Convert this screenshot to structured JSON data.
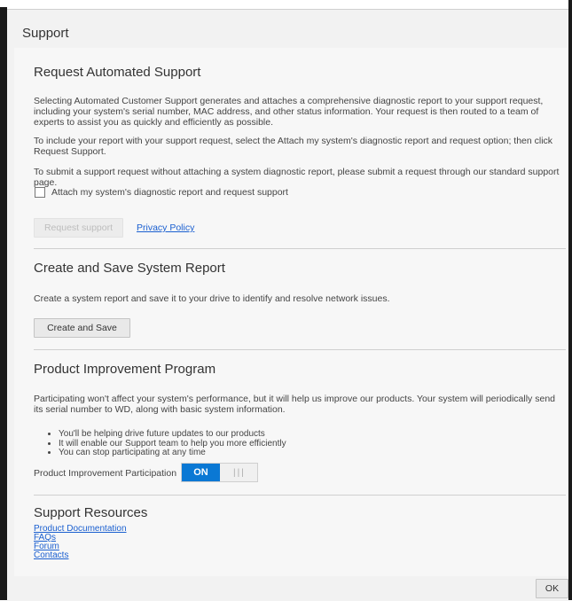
{
  "dialog": {
    "title": "Support",
    "ok_label": "OK"
  },
  "automated_support": {
    "heading": "Request Automated Support",
    "para1": "Selecting Automated Customer Support generates and attaches a comprehensive diagnostic report to your support request, including your system's serial number, MAC address, and other status information. Your request is then routed to a team of experts to assist you as quickly and efficiently as possible.",
    "para2": "To include your report with your support request, select the Attach my system's diagnostic report and request option; then click Request Support.",
    "para3": "To submit a support request without attaching a system diagnostic report, please submit a request through our standard support page.",
    "checkbox_label": "Attach my system's diagnostic report and request support",
    "checkbox_checked": false,
    "request_button": "Request support",
    "privacy_link": "Privacy Policy"
  },
  "system_report": {
    "heading": "Create and Save System Report",
    "para": "Create a system report and save it to your drive to identify and resolve network issues.",
    "button": "Create and Save"
  },
  "improvement": {
    "heading": "Product Improvement Program",
    "para": "Participating won't affect your system's performance, but it will help us improve our products. Your system will periodically send its serial number to WD, along with basic system information.",
    "bullets": [
      "You'll be helping drive future updates to our products",
      "It will enable our Support team to help you more efficiently",
      "You can stop participating at any time"
    ],
    "participation_label": "Product Improvement Participation",
    "toggle_state": "ON",
    "toggle_grip": "|||"
  },
  "resources": {
    "heading": "Support Resources",
    "links": [
      "Product Documentation",
      "FAQs",
      "Forum",
      "Contacts"
    ]
  }
}
